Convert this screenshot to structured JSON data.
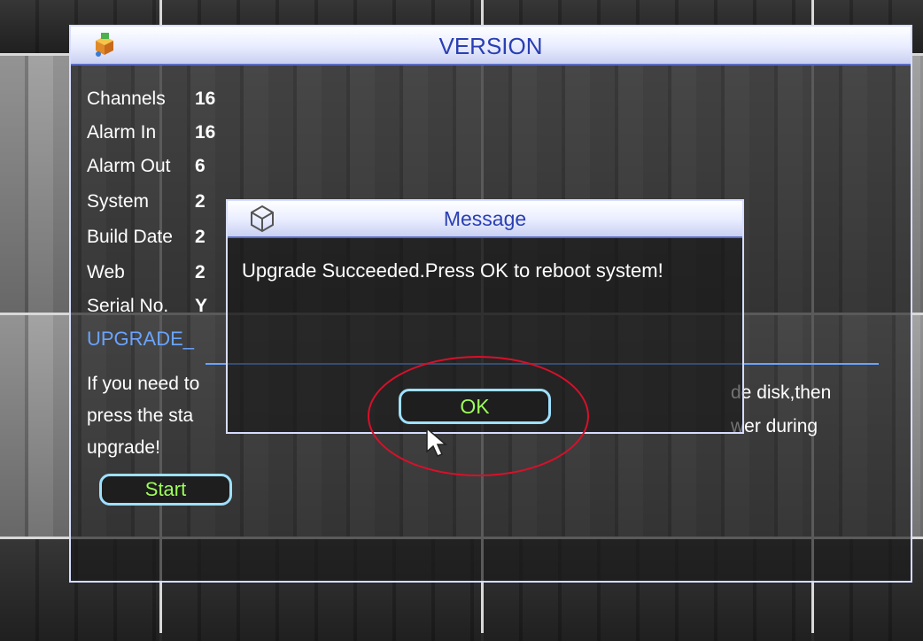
{
  "version_window": {
    "title": "VERSION",
    "icon": "app-box-icon",
    "rows": [
      {
        "label": "Channels",
        "value": "16"
      },
      {
        "label": "Alarm In",
        "value": "16"
      },
      {
        "label": "Alarm Out",
        "value": "6"
      },
      {
        "label": "System",
        "value": "2"
      },
      {
        "label": "Build Date",
        "value": "2"
      },
      {
        "label": "Web",
        "value": "2"
      },
      {
        "label": "Serial No.",
        "value": "Y"
      }
    ],
    "upgrade_heading": "UPGRADE_",
    "instructions_left": [
      "If you need to",
      "press the sta",
      "upgrade!"
    ],
    "instructions_right": [
      "de disk,then",
      "wer during"
    ],
    "start_label": "Start"
  },
  "message_dialog": {
    "title": "Message",
    "icon": "message-cube-icon",
    "text": "Upgrade Succeeded.Press OK to reboot system!",
    "ok_label": "OK"
  },
  "colors": {
    "title_text": "#2a3fb3",
    "accent_blue": "#6aa3ff",
    "button_text": "#9cff5a",
    "button_border": "#9fe0ff",
    "highlight_ellipse": "#d8102a"
  }
}
